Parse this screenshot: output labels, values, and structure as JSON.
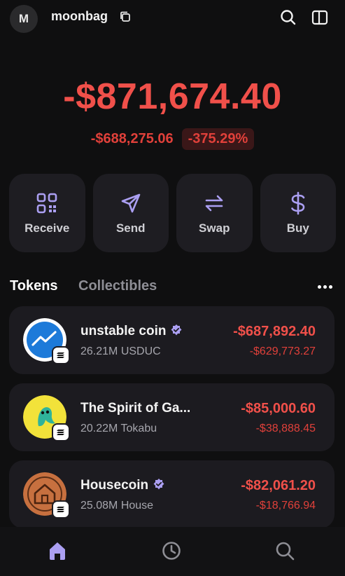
{
  "header": {
    "avatar_letter": "M",
    "wallet_name": "moonbag",
    "icons": [
      "copy-icon",
      "search-icon",
      "sidebar-panel-icon"
    ]
  },
  "balance": {
    "total": "-$871,674.40",
    "change_abs": "-$688,275.06",
    "change_pct": "-375.29%"
  },
  "actions": [
    {
      "label": "Receive",
      "icon": "qr-code-icon"
    },
    {
      "label": "Send",
      "icon": "send-icon"
    },
    {
      "label": "Swap",
      "icon": "swap-icon"
    },
    {
      "label": "Buy",
      "icon": "dollar-icon"
    }
  ],
  "tabs": {
    "tokens": "Tokens",
    "collectibles": "Collectibles",
    "active": "Tokens"
  },
  "tokens": [
    {
      "name": "unstable coin",
      "verified": true,
      "amount": "26.21M USDUC",
      "value": "-$687,892.40",
      "change": "-$629,773.27",
      "logo": "chart-up-logo"
    },
    {
      "name": "The Spirit of Ga...",
      "verified": false,
      "amount": "20.22M Tokabu",
      "value": "-$85,000.60",
      "change": "-$38,888.45",
      "logo": "green-spirit-logo"
    },
    {
      "name": "Housecoin",
      "verified": true,
      "amount": "25.08M House",
      "value": "-$82,061.20",
      "change": "-$18,766.94",
      "logo": "house-logo"
    }
  ],
  "bottom_nav": [
    {
      "name": "home",
      "icon": "home-icon",
      "active": true
    },
    {
      "name": "history",
      "icon": "clock-icon",
      "active": false
    },
    {
      "name": "search",
      "icon": "search-icon",
      "active": false
    }
  ],
  "colors": {
    "background": "#0f0f10",
    "negative": "#f0504a",
    "accent": "#ab9ff2",
    "card": "#1c1b20",
    "verified": "#ab9ff2"
  }
}
